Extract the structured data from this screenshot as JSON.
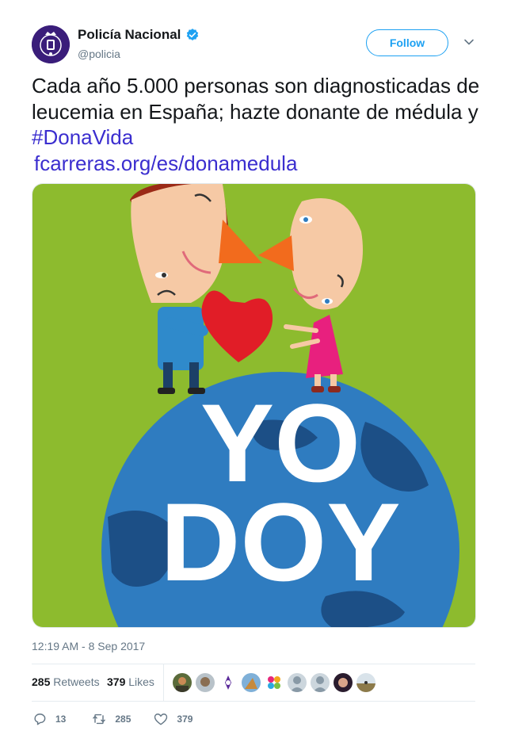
{
  "account": {
    "display_name": "Policía Nacional",
    "handle": "@policia",
    "verified": true
  },
  "follow_label": "Follow",
  "tweet": {
    "text": "Cada año 5.000 personas son diagnosticadas de leucemia en España; hazte donante de médula y ",
    "hashtag": "#DonaVida",
    "link": "fcarreras.org/es/donamedula"
  },
  "media": {
    "line1": "YO",
    "line2": "DOY"
  },
  "timestamp": "12:19 AM - 8 Sep 2017",
  "stats": {
    "retweets_count": "285",
    "retweets_label": "Retweets",
    "likes_count": "379",
    "likes_label": "Likes"
  },
  "actions": {
    "reply_count": "13",
    "retweet_count": "285",
    "like_count": "379"
  },
  "colors": {
    "accent": "#1da1f2",
    "link": "#3b2ecf",
    "media_bg": "#8dbb2e",
    "globe": "#2f7cc0"
  }
}
